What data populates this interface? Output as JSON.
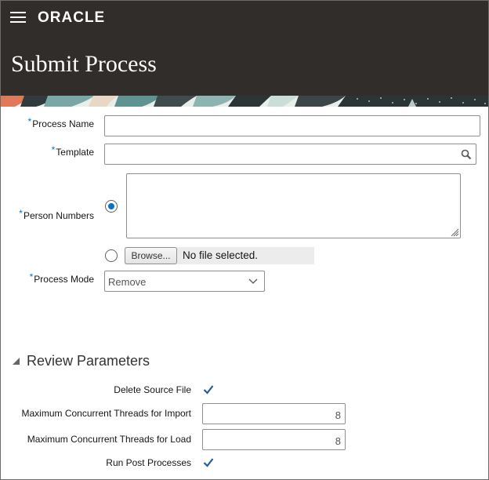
{
  "header": {
    "logo": "ORACLE",
    "title": "Submit Process",
    "menu_icon": "hamburger-menu-icon"
  },
  "form": {
    "required_mark": "*",
    "process_name": {
      "label": "Process Name",
      "value": ""
    },
    "template": {
      "label": "Template",
      "value": "",
      "icon": "search-icon"
    },
    "person_numbers": {
      "label": "Person Numbers",
      "value": "",
      "mode": "text-entry"
    },
    "file_upload": {
      "browse_label": "Browse...",
      "status": "No file selected."
    },
    "process_mode": {
      "label": "Process Mode",
      "value": "Remove"
    }
  },
  "review": {
    "title": "Review Parameters",
    "expanded": true,
    "delete_source_file": {
      "label": "Delete Source File",
      "checked": true
    },
    "threads_import": {
      "label": "Maximum Concurrent Threads for Import",
      "value": "8"
    },
    "threads_load": {
      "label": "Maximum Concurrent Threads for Load",
      "value": "8"
    },
    "run_post_processes": {
      "label": "Run Post Processes",
      "checked": true
    }
  },
  "colors": {
    "header_bg": "#312d2a",
    "accent": "#0572ce",
    "checkmark": "#1f5f9e"
  }
}
